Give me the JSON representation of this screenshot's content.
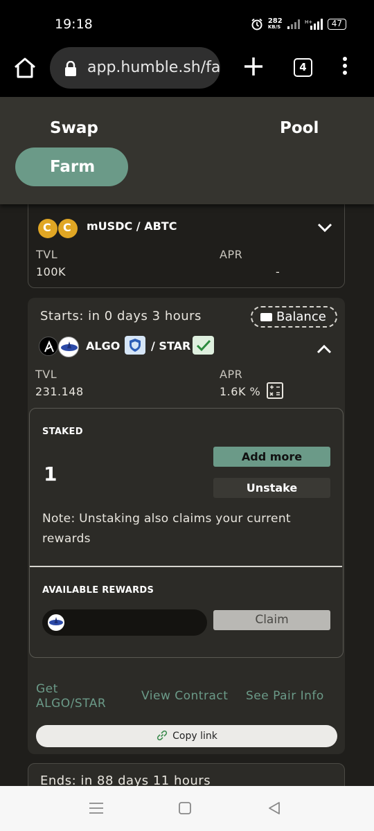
{
  "status_bar": {
    "time": "19:18",
    "speed_value": "282",
    "speed_unit": "KB/S",
    "battery": "47"
  },
  "browser": {
    "url": "app.humble.sh/fa",
    "tab_count": "4"
  },
  "nav": {
    "swap": "Swap",
    "pool": "Pool",
    "farm": "Farm"
  },
  "pool1": {
    "pair": "mUSDC / ABTC",
    "tvl_label": "TVL",
    "tvl_value": "100K",
    "apr_label": "APR",
    "apr_value": "-"
  },
  "pool2": {
    "starts": "Starts: in 0 days 3 hours",
    "balance_label": "Balance",
    "token_a": "ALGO",
    "token_b": "/ STAR",
    "tvl_label": "TVL",
    "tvl_value": "231.148",
    "apr_label": "APR",
    "apr_value": "1.6K %",
    "staked_title": "STAKED",
    "staked_amount": "1",
    "add_more": "Add more",
    "unstake": "Unstake",
    "note": "Note: Unstaking also claims your current rewards",
    "rewards_title": "AVAILABLE REWARDS",
    "claim": "Claim",
    "link_get_1": "Get",
    "link_get_2": "ALGO/STAR",
    "link_contract": "View Contract",
    "link_pair": "See Pair Info",
    "copy_link": "Copy link"
  },
  "pool3": {
    "ends": "Ends: in 88 days 11 hours"
  },
  "colors": {
    "accent": "#6b9a88",
    "background": "#1f1e1b",
    "card": "#2c2b27"
  }
}
